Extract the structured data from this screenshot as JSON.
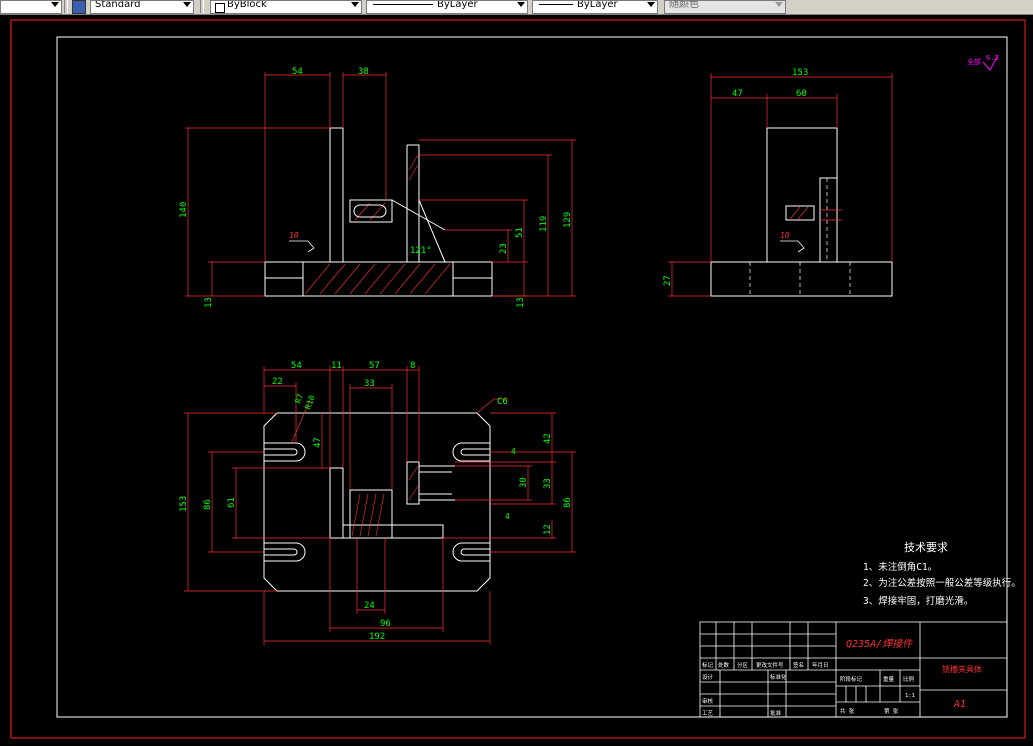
{
  "toolbar": {
    "text_style": "Standard",
    "color": "ByBlock",
    "linetype": "ByLayer",
    "lineweight": "ByLayer",
    "plot_style": "随颜色"
  },
  "colors": {
    "outline": "#ffffff",
    "dimension": "#ff3030",
    "dim_text": "#00ff00",
    "border_red": "#ff2020",
    "title_text": "#ff3030",
    "roughness_mark": "#ff00ff"
  },
  "drawing": {
    "roughness_label": "全部",
    "roughness_value": "6.3",
    "front_view_dims": {
      "top_54": "54",
      "top_38": "38",
      "left_140": "140",
      "bottom_13_left": "13",
      "bottom_13_right": "13",
      "d23": "23",
      "d51": "51",
      "d119": "119",
      "d129": "129",
      "angle": "121°",
      "weld_size": "10"
    },
    "side_view_dims": {
      "top_153": "153",
      "d47": "47",
      "d60": "60",
      "d27": "27",
      "weld_size": "10"
    },
    "top_view_dims": {
      "d54": "54",
      "d11": "11",
      "d57": "57",
      "d8": "8",
      "d22": "22",
      "d33": "33",
      "r7": "R7",
      "r10": "R10",
      "c6": "C6",
      "d47": "47",
      "d153": "153",
      "d86_left": "86",
      "d61": "61",
      "d42": "42",
      "d4_top": "4",
      "d30": "30",
      "d33_right": "33",
      "d86_right": "86",
      "d4_bottom": "4",
      "d12": "12",
      "d24": "24",
      "d96": "96",
      "d192": "192"
    }
  },
  "technical_requirements": {
    "heading": "技术要求",
    "items": [
      "1、未注倒角C1。",
      "2、为注公差按照一般公差等级执行。",
      "3、焊接牢固，打磨光滑。"
    ]
  },
  "title_block": {
    "material": "Q235A/焊接件",
    "part_name": "铣槽夹具体",
    "drawing_number": "A1",
    "labels": {
      "mark": "标记",
      "count": "处数",
      "zone": "分区",
      "change_doc": "更改文件号",
      "sign": "签名",
      "date": "年月日",
      "designer": "设计",
      "standardize": "标准化",
      "stage_mark": "阶段标记",
      "weight": "重量",
      "scale": "比例",
      "ratio": "1:1",
      "reviewer": "审核",
      "process": "工艺",
      "approve": "批准",
      "sheets": "共 张",
      "sheet": "第 张"
    }
  }
}
